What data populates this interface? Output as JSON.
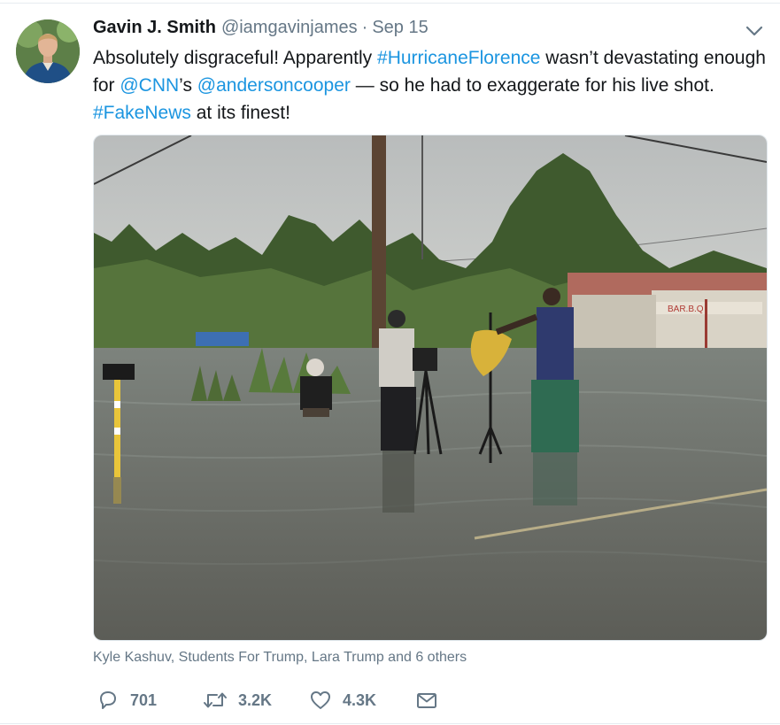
{
  "tweet": {
    "author_name": "Gavin J. Smith",
    "handle": "@iamgavinjames",
    "separator": "·",
    "date": "Sep 15",
    "text": {
      "part1": "Absolutely disgraceful! Apparently ",
      "hashtag1": "#HurricaneFlorence",
      "part2": " wasn’t devastating enough for ",
      "mention1": "@CNN",
      "part3": "’s ",
      "mention2": "@andersoncooper",
      "part4": " — so he had to exaggerate for his live shot. ",
      "hashtag2": "#FakeNews",
      "part5": " at its finest!"
    },
    "liked_by": "Kyle Kashuv, Students For Trump, Lara Trump and 6 others",
    "counts": {
      "replies": "701",
      "retweets": "3.2K",
      "likes": "4.3K"
    }
  },
  "icons": {
    "caret": "chevron-down-icon",
    "reply": "reply-icon",
    "retweet": "retweet-icon",
    "like": "heart-icon",
    "message": "envelope-icon"
  },
  "colors": {
    "link": "#1b95e0",
    "muted": "#657786",
    "text": "#14171a"
  }
}
